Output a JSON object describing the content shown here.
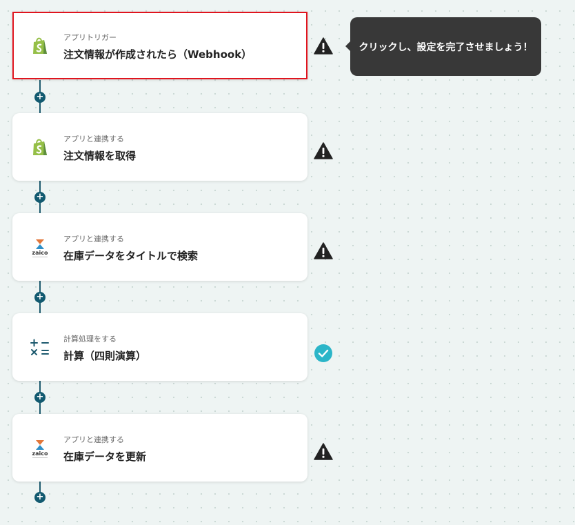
{
  "steps": [
    {
      "subtitle": "アプリトリガー",
      "title": "注文情報が作成されたら（Webhook）",
      "icon": "shopify-icon",
      "status": "warning"
    },
    {
      "subtitle": "アプリと連携する",
      "title": "注文情報を取得",
      "icon": "shopify-icon",
      "status": "warning"
    },
    {
      "subtitle": "アプリと連携する",
      "title": "在庫データをタイトルで検索",
      "icon": "zaico-icon",
      "status": "warning"
    },
    {
      "subtitle": "計算処理をする",
      "title": "計算（四則演算）",
      "icon": "calculator-icon",
      "status": "complete"
    },
    {
      "subtitle": "アプリと連携する",
      "title": "在庫データを更新",
      "icon": "zaico-icon",
      "status": "warning"
    }
  ],
  "zaico_logo_text": "zaico",
  "add_button_symbol": "+",
  "tooltip": {
    "text": "クリックし、設定を完了させましょう！"
  },
  "colors": {
    "selected_border": "#e0141e",
    "connector": "#1d5a6e",
    "complete": "#2bb5c8",
    "shopify": "#95bf47"
  }
}
